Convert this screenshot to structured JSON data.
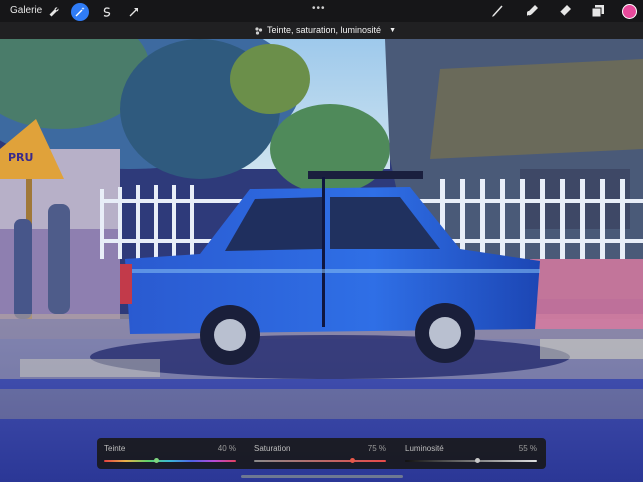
{
  "toolbar": {
    "gallery_label": "Galerie",
    "left_tools": [
      "wrench-icon",
      "magic-wand-icon",
      "selection-icon",
      "move-arrow-icon"
    ],
    "active_tool": "magic-wand-icon",
    "more_label": "•••",
    "right_tools": [
      "brush-icon",
      "smudge-icon",
      "eraser-icon",
      "layers-icon"
    ],
    "current_color": "#e84a9c"
  },
  "adjustment": {
    "title": "Teinte, saturation, luminosité",
    "sliders": [
      {
        "label": "Teinte",
        "value": "40 %",
        "level": 0.4
      },
      {
        "label": "Saturation",
        "value": "75 %",
        "level": 0.75
      },
      {
        "label": "Luminosité",
        "value": "55 %",
        "level": 0.55
      }
    ]
  },
  "colors": {
    "accent": "#2f7cf6",
    "toolbar_bg": "#161618"
  }
}
